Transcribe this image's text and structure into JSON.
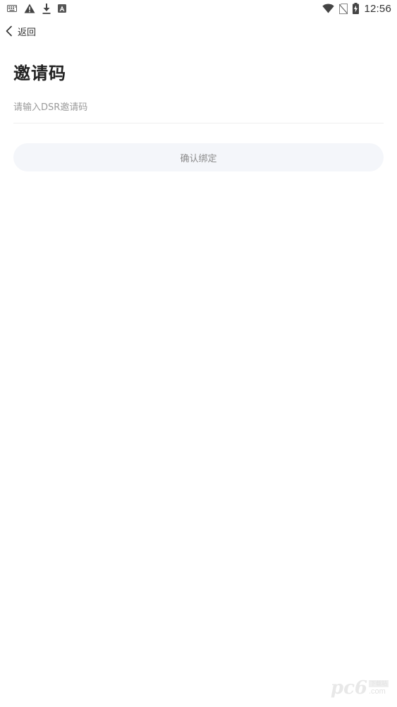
{
  "status_bar": {
    "left_icons": [
      "keyboard-icon",
      "warning-icon",
      "download-icon",
      "app-notification-icon"
    ],
    "right_icons": [
      "wifi-icon",
      "no-sim-icon",
      "battery-charging-icon"
    ],
    "time": "12:56"
  },
  "header": {
    "back_label": "返回"
  },
  "page": {
    "title": "邀请码"
  },
  "invite_input": {
    "value": "",
    "placeholder": "请输入DSR邀请码"
  },
  "confirm_button": {
    "label": "确认绑定"
  },
  "watermark": {
    "logo": "pc6",
    "cn": "下载站",
    "domain": ".com"
  },
  "colors": {
    "button_bg": "#f4f6fa",
    "button_text": "#8a8a8a",
    "placeholder": "#9a9a9a",
    "divider": "#eeeeee",
    "title": "#222222"
  }
}
